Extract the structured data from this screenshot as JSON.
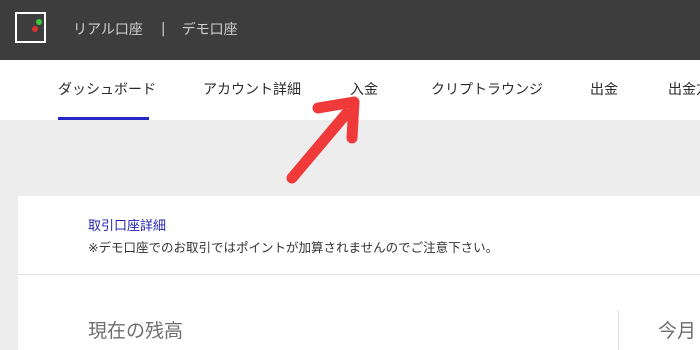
{
  "header": {
    "real_account": "リアル口座",
    "separator": "|",
    "demo_account": "デモ口座"
  },
  "nav": {
    "tabs": [
      {
        "label": "ダッシュボード",
        "active": true
      },
      {
        "label": "アカウント詳細"
      },
      {
        "label": "入金"
      },
      {
        "label": "クリプトラウンジ"
      },
      {
        "label": "出金"
      },
      {
        "label": "出金方"
      }
    ]
  },
  "panel": {
    "detail_link": "取引口座詳細",
    "notice": "※デモ口座でのお取引ではポイントが加算されませんのでご注意下さい。",
    "balance_title": "現在の残高",
    "month_title": "今月"
  },
  "colors": {
    "header_bg": "#3d3d3d",
    "active_underline": "#2626c6",
    "link": "#2424b0",
    "arrow": "#f03a3a"
  },
  "icons": {
    "logo": "brand-logo-icon",
    "annotation": "red-arrow-icon"
  }
}
